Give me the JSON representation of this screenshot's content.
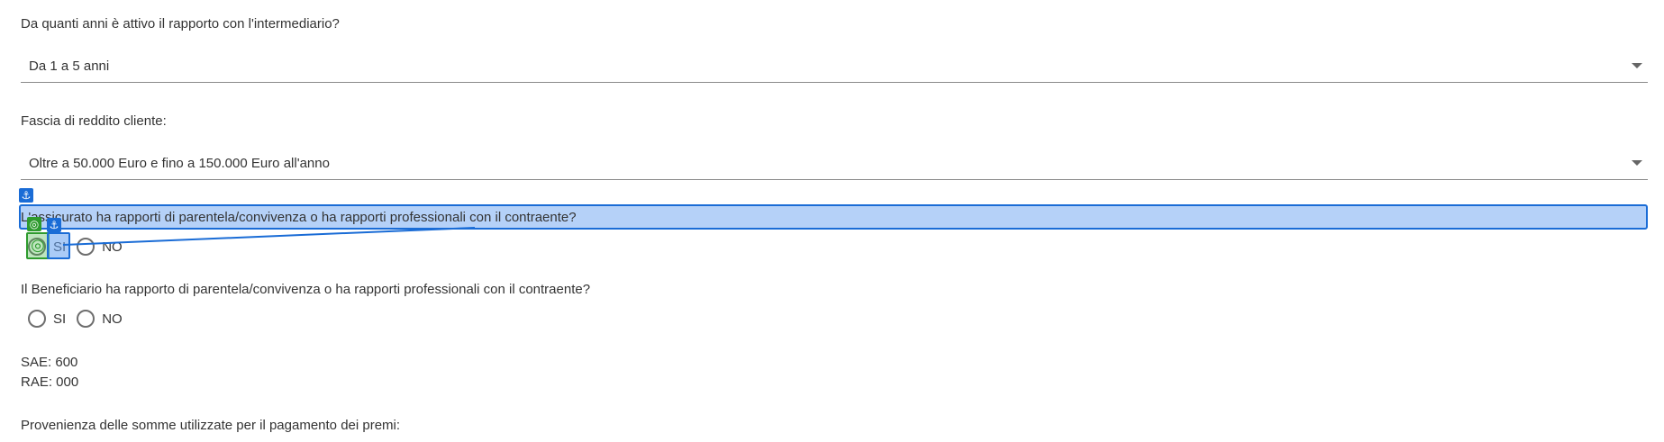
{
  "questions": {
    "years": {
      "label": "Da quanti anni è attivo il rapporto con l'intermediario?",
      "value": "Da 1 a 5 anni"
    },
    "income": {
      "label": "Fascia di reddito cliente:",
      "value": "Oltre a 50.000 Euro e fino a 150.000 Euro all'anno"
    },
    "insured": {
      "label": "L'assicurato ha rapporti di parentela/convivenza o ha rapporti professionali con il contraente?",
      "options": [
        "SI",
        "NO"
      ]
    },
    "beneficiary": {
      "label": "Il Beneficiario ha rapporto di parentela/convivenza o ha rapporti professionali con il contraente?",
      "options": [
        "SI",
        "NO"
      ]
    }
  },
  "codes": {
    "sae": "SAE: 600",
    "rae": "RAE: 000"
  },
  "provenance_label": "Provenienza delle somme utilizzate per il pagamento dei premi:",
  "overlay": {
    "anchor_icon": "anchor-icon",
    "target_icon": "target-icon",
    "colors": {
      "selection": "#1a6cd6",
      "target": "#2e9b2e"
    }
  }
}
